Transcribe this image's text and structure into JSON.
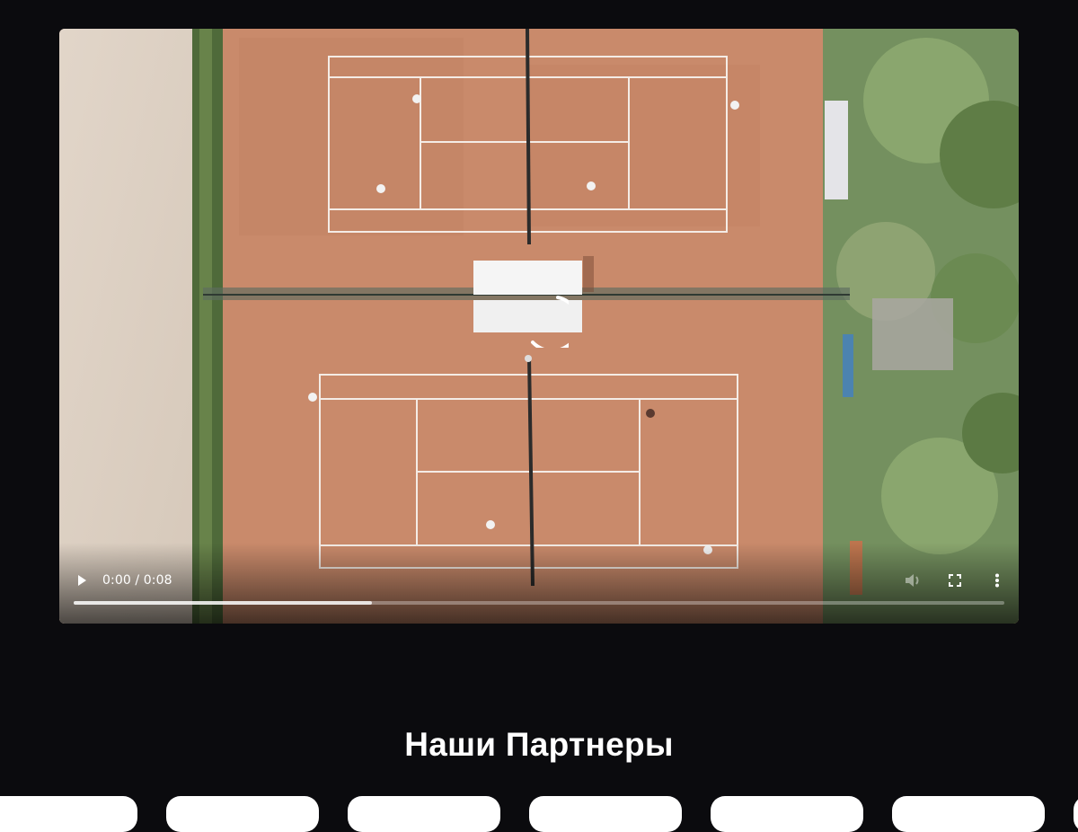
{
  "video": {
    "time_display": "0:00 / 0:08",
    "progress_fraction": 0.32,
    "icons": {
      "play": "play-icon",
      "volume": "volume-icon",
      "fullscreen": "fullscreen-icon",
      "more": "more-vert-icon",
      "loading": "loading-spinner-icon"
    },
    "colors": {
      "clay": "#c98a6b",
      "sand": "#ddd0c2",
      "foliage": "#6f8a57"
    }
  },
  "partners": {
    "title": "Наши Партнеры",
    "cards": [
      {
        "name": "partner-card-1"
      },
      {
        "name": "partner-card-2"
      },
      {
        "name": "partner-card-3"
      },
      {
        "name": "partner-card-4"
      },
      {
        "name": "partner-card-5"
      },
      {
        "name": "partner-card-6"
      },
      {
        "name": "partner-card-7"
      }
    ]
  },
  "colors": {
    "background": "#0b0b0e",
    "title": "#ffffff",
    "card": "#ffffff"
  }
}
